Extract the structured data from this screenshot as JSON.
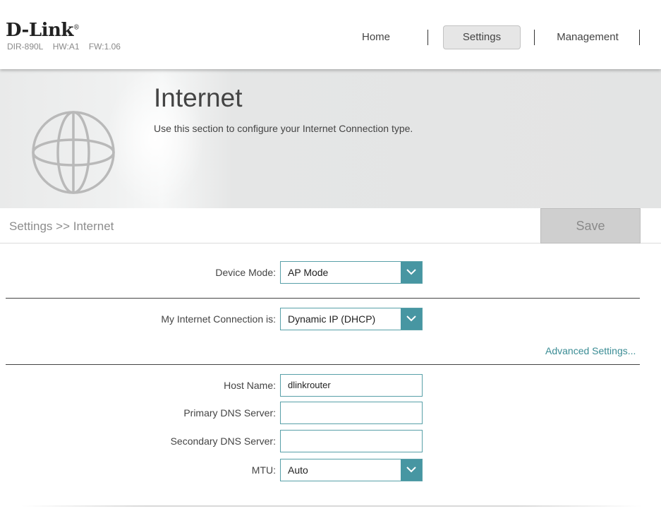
{
  "header": {
    "logo_text": "D-Link",
    "logo_mark": "®",
    "model": "DIR-890L",
    "hw": "HW:A1",
    "fw": "FW:1.06"
  },
  "nav": {
    "home": "Home",
    "settings": "Settings",
    "management": "Management",
    "active": "Settings"
  },
  "banner": {
    "title": "Internet",
    "description": "Use this section to configure your Internet Connection type.",
    "icon": "globe-icon"
  },
  "breadcrumb": "Settings >> Internet",
  "save_label": "Save",
  "form": {
    "device_mode": {
      "label": "Device Mode:",
      "value": "AP Mode"
    },
    "connection": {
      "label": "My Internet Connection is:",
      "value": "Dynamic IP (DHCP)"
    },
    "advanced_link": "Advanced Settings...",
    "host_name": {
      "label": "Host Name:",
      "value": "dlinkrouter"
    },
    "primary_dns": {
      "label": "Primary DNS Server:",
      "value": ""
    },
    "secondary_dns": {
      "label": "Secondary DNS Server:",
      "value": ""
    },
    "mtu": {
      "label": "MTU:",
      "value": "Auto"
    }
  },
  "colors": {
    "accent": "#4796a2",
    "link": "#3a8c94",
    "save_bg": "#cfcfcf"
  }
}
